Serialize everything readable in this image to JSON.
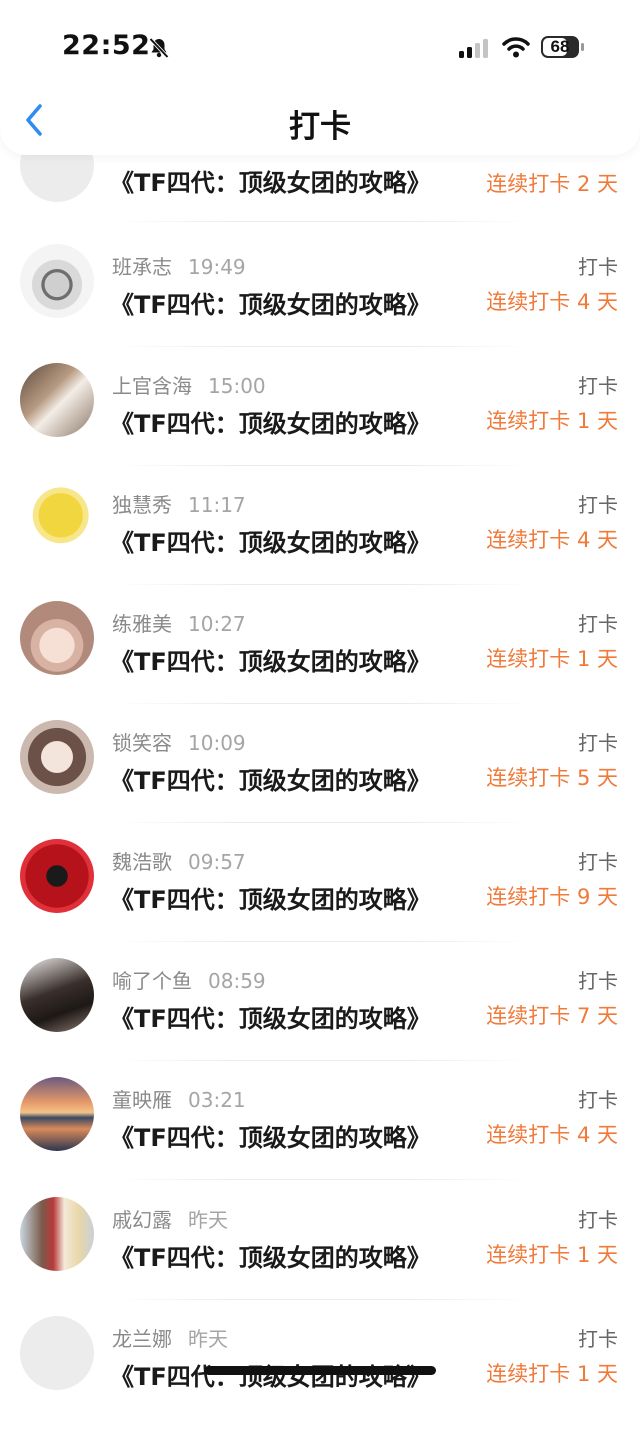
{
  "status": {
    "time": "22:52",
    "battery": "68"
  },
  "nav": {
    "title": "打卡"
  },
  "first_row": {
    "course": "《TF四代：顶级女团的攻略》",
    "streak": "连续打卡 2 天"
  },
  "rows": [
    {
      "name": "班承志",
      "time": "19:49",
      "course": "《TF四代：顶级女团的攻略》",
      "action": "打卡",
      "streak": "连续打卡 4 天",
      "avatar": "pocket-watch"
    },
    {
      "name": "上官含海",
      "time": "15:00",
      "course": "《TF四代：顶级女团的攻略》",
      "action": "打卡",
      "streak": "连续打卡 1 天",
      "avatar": "photo-people"
    },
    {
      "name": "独慧秀",
      "time": "11:17",
      "course": "《TF四代：顶级女团的攻略》",
      "action": "打卡",
      "streak": "连续打卡 4 天",
      "avatar": "yellow-cartoon"
    },
    {
      "name": "练雅美",
      "time": "10:27",
      "course": "《TF四代：顶级女团的攻略》",
      "action": "打卡",
      "streak": "连续打卡 1 天",
      "avatar": "anime-girl"
    },
    {
      "name": "锁笑容",
      "time": "10:09",
      "course": "《TF四代：顶级女团的攻略》",
      "action": "打卡",
      "streak": "连续打卡 5 天",
      "avatar": "girl-portrait"
    },
    {
      "name": "魏浩歌",
      "time": "09:57",
      "course": "《TF四代：顶级女团的攻略》",
      "action": "打卡",
      "streak": "连续打卡 9 天",
      "avatar": "butterfly-red"
    },
    {
      "name": "喻了个鱼",
      "time": "08:59",
      "course": "《TF四代：顶级女团的攻略》",
      "action": "打卡",
      "streak": "连续打卡 7 天",
      "avatar": "dark-photo"
    },
    {
      "name": "童映雁",
      "time": "03:21",
      "course": "《TF四代：顶级女团的攻略》",
      "action": "打卡",
      "streak": "连续打卡 4 天",
      "avatar": "sunset-sea"
    },
    {
      "name": "戚幻露",
      "time": "昨天",
      "course": "《TF四代：顶级女团的攻略》",
      "action": "打卡",
      "streak": "连续打卡 1 天",
      "avatar": "couple-photo"
    },
    {
      "name": "龙兰娜",
      "time": "昨天",
      "course": "《TF四代：顶级女团的攻略》",
      "action": "打卡",
      "streak": "连续打卡 1 天",
      "avatar": "default-grey"
    }
  ],
  "colors": {
    "accent": "#2f8cf0",
    "streak": "#f07a3a"
  }
}
